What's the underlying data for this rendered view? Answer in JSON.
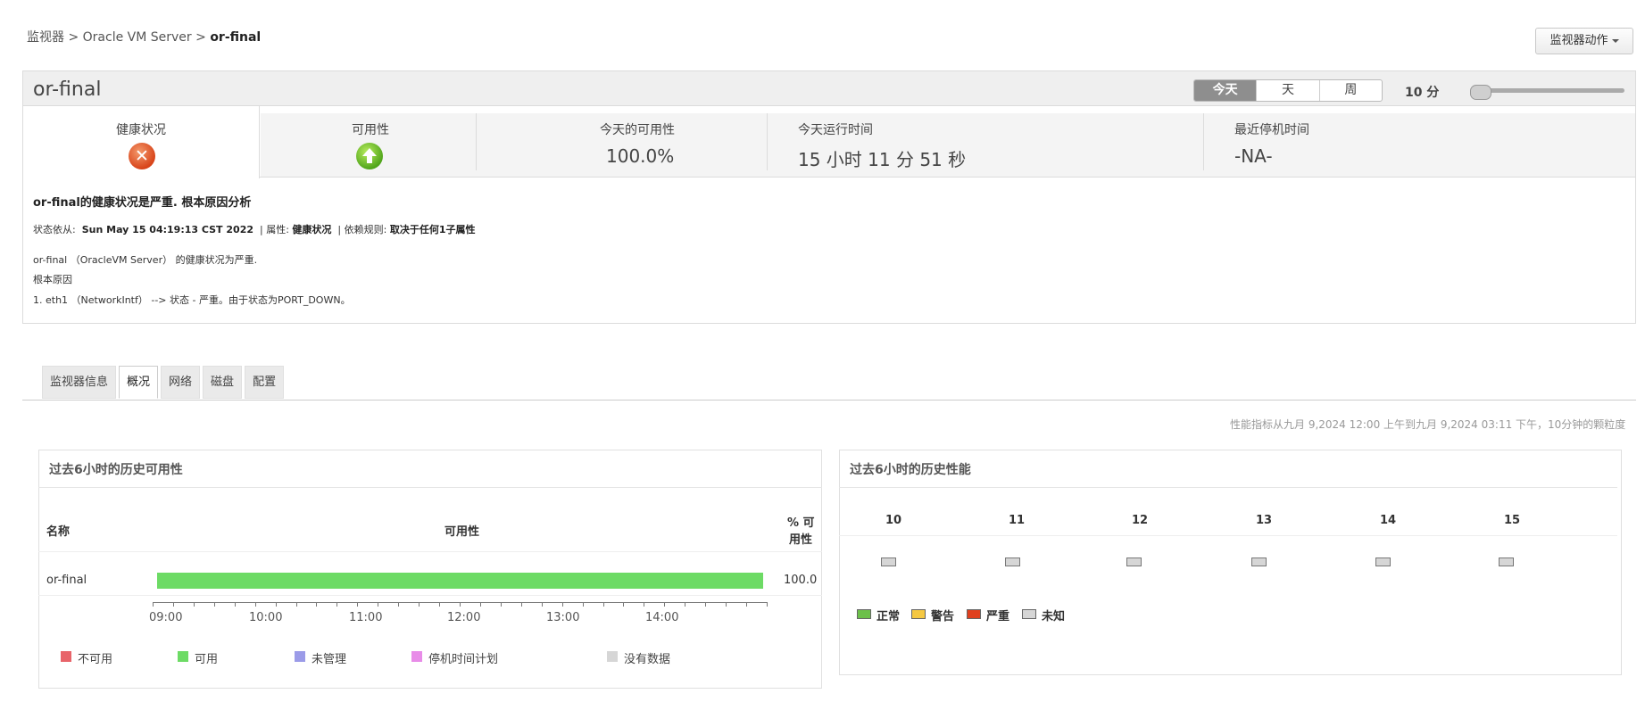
{
  "breadcrumb": {
    "part1": "监视器",
    "sep": ">",
    "part2": "Oracle VM Server",
    "current": "or-final"
  },
  "actions_button": "监视器动作",
  "header": {
    "title": "or-final",
    "period_tabs": [
      {
        "label": "今天",
        "active": true
      },
      {
        "label": "天",
        "active": false
      },
      {
        "label": "周",
        "active": false
      }
    ],
    "granularity": "10 分"
  },
  "stats": {
    "health_label": "健康状况",
    "health_status": "critical",
    "availability_label": "可用性",
    "availability_status": "up",
    "today_avail_label": "今天的可用性",
    "today_avail_value": "100.0%",
    "uptime_label": "今天运行时间",
    "uptime_value": "15 小时 11 分 51 秒",
    "downtime_label": "最近停机时间",
    "downtime_value": "-NA-"
  },
  "root_cause": {
    "title": "or-final的健康状况是严重. 根本原因分析",
    "since_label": "状态依从:",
    "since_value": "Sun May 15 04:19:13 CST 2022",
    "attr_label": "属性:",
    "attr_value": "健康状况",
    "rule_label": "依赖规则:",
    "rule_value": "取决于任何1子属性",
    "line1": "or-final （OracleVM Server） 的健康状况为严重.",
    "line2": "根本原因",
    "line3": "1. eth1 （NetworkIntf） --> 状态 - 严重。由于状态为PORT_DOWN。"
  },
  "tabs": [
    {
      "label": "监视器信息",
      "active": false
    },
    {
      "label": "概况",
      "active": true
    },
    {
      "label": "网络",
      "active": false
    },
    {
      "label": "磁盘",
      "active": false
    },
    {
      "label": "配置",
      "active": false
    }
  ],
  "perf_note": "性能指标从九月 9,2024 12:00 上午到九月 9,2024 03:11 下午，10分钟的颗粒度",
  "availability_panel": {
    "title": "过去6小时的历史可用性",
    "col_name": "名称",
    "col_avail": "可用性",
    "col_pct_1": "% 可",
    "col_pct_2": "用性",
    "rows": [
      {
        "name": "or-final",
        "pct": "100.0",
        "status": "available"
      }
    ],
    "time_labels": [
      "09:00",
      "10:00",
      "11:00",
      "12:00",
      "13:00",
      "14:00"
    ],
    "legend": [
      {
        "label": "不可用",
        "color": "#e8646a"
      },
      {
        "label": "可用",
        "color": "#6ddb65"
      },
      {
        "label": "未管理",
        "color": "#9b9be8"
      },
      {
        "label": "停机时间计划",
        "color": "#e88ce8"
      },
      {
        "label": "没有数据",
        "color": "#d6d6d6"
      }
    ]
  },
  "performance_panel": {
    "title": "过去6小时的历史性能",
    "hours": [
      "10",
      "11",
      "12",
      "13",
      "14",
      "15"
    ],
    "cell_status": [
      "unknown",
      "unknown",
      "unknown",
      "unknown",
      "unknown",
      "unknown"
    ],
    "legend": [
      {
        "label": "正常",
        "color": "#6cc04a"
      },
      {
        "label": "警告",
        "color": "#f5c842"
      },
      {
        "label": "严重",
        "color": "#e0401e"
      },
      {
        "label": "未知",
        "color": "#d6d6d6"
      }
    ]
  }
}
